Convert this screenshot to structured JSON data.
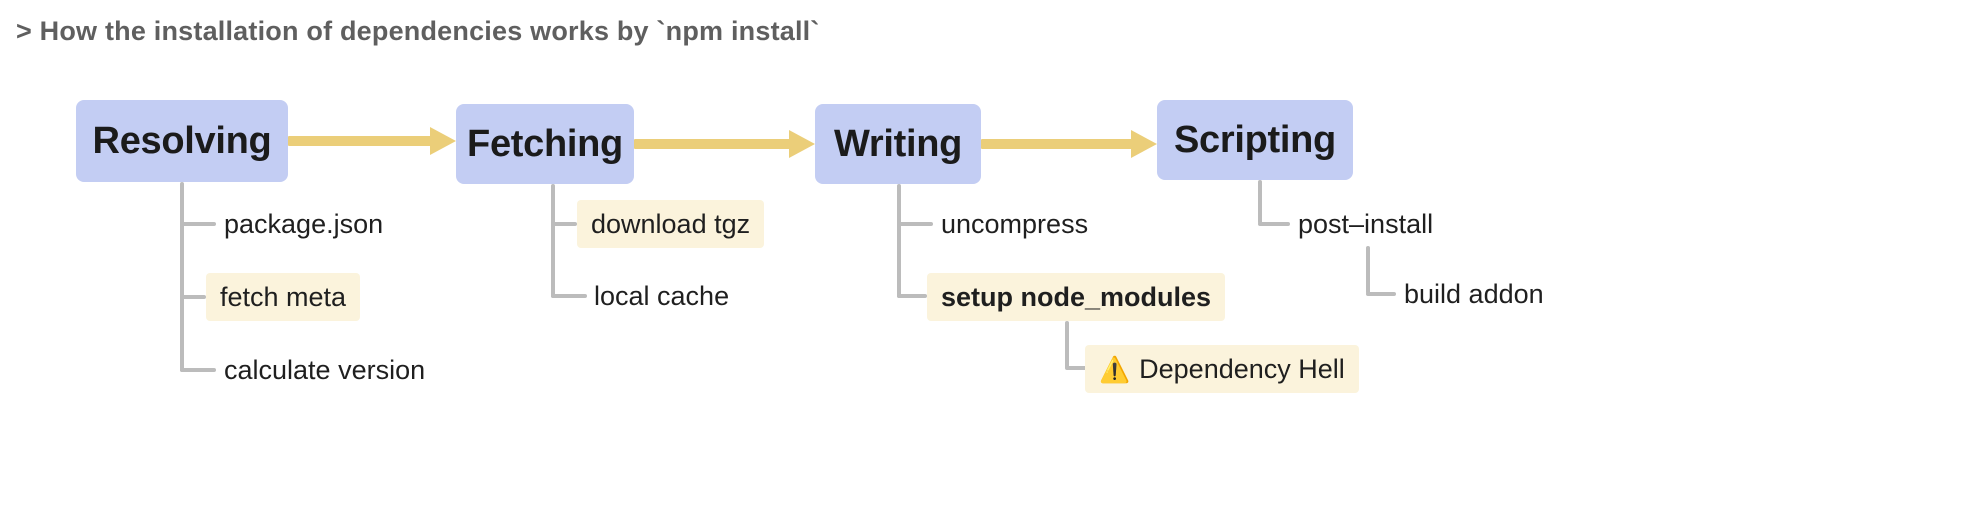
{
  "title": "> How the installation of dependencies works by `npm install`",
  "colors": {
    "stage_fill": "#c3cdf3",
    "arrow": "#ebce79",
    "connector": "#bcbcbc",
    "highlight": "#fbf3dc",
    "title_text": "#5f5f5f",
    "body_text": "#1f1f1f",
    "warning": "#f5c518"
  },
  "diagram": {
    "type": "flow-tree",
    "stages": [
      {
        "id": "resolving",
        "label": "Resolving",
        "children": [
          {
            "label": "package.json",
            "highlight": false,
            "bold": false,
            "warning": false
          },
          {
            "label": "fetch meta",
            "highlight": true,
            "bold": false,
            "warning": false
          },
          {
            "label": "calculate version",
            "highlight": false,
            "bold": false,
            "warning": false
          }
        ]
      },
      {
        "id": "fetching",
        "label": "Fetching",
        "children": [
          {
            "label": "download tgz",
            "highlight": true,
            "bold": false,
            "warning": false
          },
          {
            "label": "local cache",
            "highlight": false,
            "bold": false,
            "warning": false
          }
        ]
      },
      {
        "id": "writing",
        "label": "Writing",
        "children": [
          {
            "label": "uncompress",
            "highlight": false,
            "bold": false,
            "warning": false
          },
          {
            "label": "setup node_modules",
            "highlight": true,
            "bold": true,
            "warning": false
          },
          {
            "label": "Dependency Hell",
            "highlight": true,
            "bold": false,
            "warning": true,
            "icon": "warning-triangle-icon",
            "icon_glyph": "⚠️"
          }
        ]
      },
      {
        "id": "scripting",
        "label": "Scripting",
        "children": [
          {
            "label": "post–install",
            "highlight": false,
            "bold": false,
            "warning": false
          },
          {
            "label": "build addon",
            "highlight": false,
            "bold": false,
            "warning": false
          }
        ]
      }
    ],
    "arrows": [
      {
        "from": "resolving",
        "to": "fetching"
      },
      {
        "from": "fetching",
        "to": "writing"
      },
      {
        "from": "writing",
        "to": "scripting"
      }
    ]
  }
}
